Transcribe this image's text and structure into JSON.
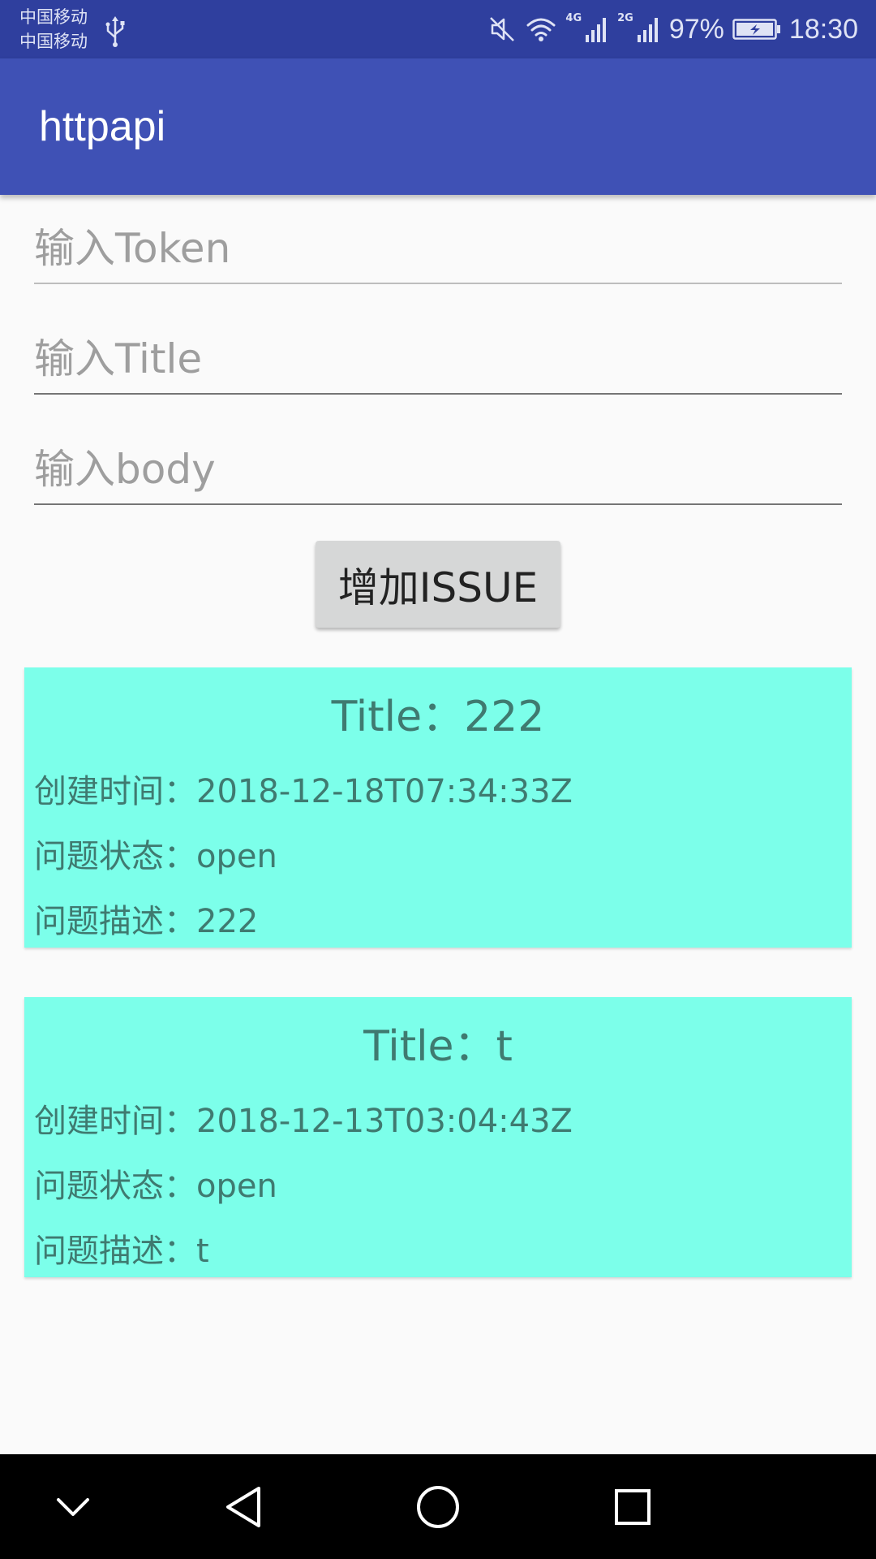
{
  "status_bar": {
    "carrier_1": "中国移动",
    "carrier_2": "中国移动",
    "net_1": "4G",
    "net_2": "2G",
    "battery": "97%",
    "time": "18:30"
  },
  "app_bar": {
    "title": "httpapi"
  },
  "form": {
    "token_placeholder": "输入Token",
    "title_placeholder": "输入Title",
    "body_placeholder": "输入body",
    "add_button_label": "增加ISSUE"
  },
  "issues": [
    {
      "title": "Title：222",
      "created_label": "创建时间：",
      "created_value": "2018-12-18T07:34:33Z",
      "state_label": "问题状态：",
      "state_value": "open",
      "desc_label": "问题描述：",
      "desc_value": "222"
    },
    {
      "title": "Title：t",
      "created_label": "创建时间：",
      "created_value": "2018-12-13T03:04:43Z",
      "state_label": "问题状态：",
      "state_value": "open",
      "desc_label": "问题描述：",
      "desc_value": "t"
    }
  ],
  "colors": {
    "status_bar": "#2f3f9e",
    "app_bar": "#3f51b5",
    "card_bg": "#7cffea",
    "card_text": "#3f7a70",
    "button_bg": "#d6d7d7"
  },
  "icons": {
    "status": [
      "usb-icon",
      "mute-icon",
      "wifi-icon",
      "signal-icon",
      "battery-icon"
    ],
    "nav": [
      "collapse-icon",
      "back-icon",
      "home-icon",
      "recents-icon"
    ]
  }
}
